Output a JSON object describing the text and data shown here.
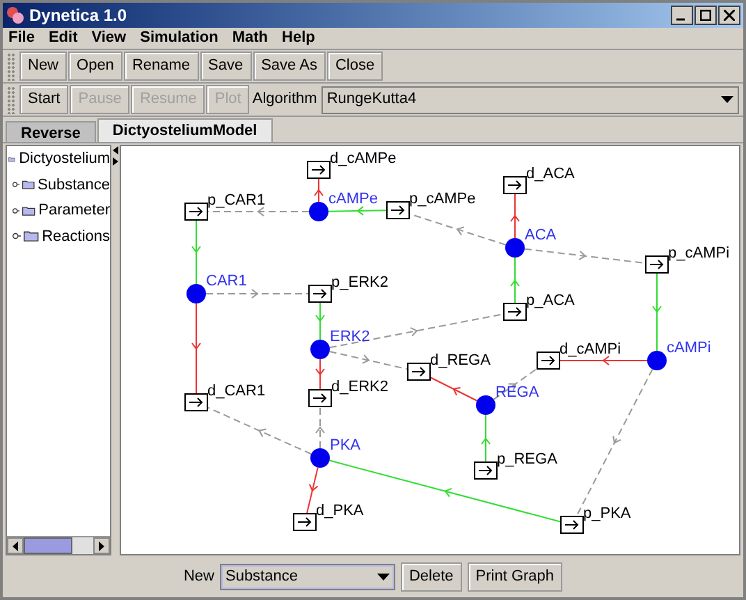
{
  "window": {
    "title": "Dynetica 1.0"
  },
  "menu": [
    "File",
    "Edit",
    "View",
    "Simulation",
    "Math",
    "Help"
  ],
  "toolbar": [
    {
      "label": "New",
      "disabled": false
    },
    {
      "label": "Open",
      "disabled": false
    },
    {
      "label": "Rename",
      "disabled": false
    },
    {
      "label": "Save",
      "disabled": false
    },
    {
      "label": "Save As",
      "disabled": false
    },
    {
      "label": "Close",
      "disabled": false
    }
  ],
  "sim_toolbar": {
    "buttons": [
      {
        "label": "Start",
        "disabled": false
      },
      {
        "label": "Pause",
        "disabled": true
      },
      {
        "label": "Resume",
        "disabled": true
      },
      {
        "label": "Plot",
        "disabled": true
      }
    ],
    "algorithm_label": "Algorithm",
    "algorithm": "RungeKutta4"
  },
  "tabs": [
    {
      "label": "Reverse",
      "selected": false
    },
    {
      "label": "DictyosteliumModel",
      "selected": true
    }
  ],
  "tree": {
    "label": "Dictyostelium",
    "children": [
      {
        "label": "Substance"
      },
      {
        "label": "Parameter"
      },
      {
        "label": "Reactions"
      }
    ]
  },
  "graph": {
    "nodes": [
      {
        "kind": "reaction",
        "label": "d_cAMPe"
      },
      {
        "kind": "reaction",
        "label": "d_ACA"
      },
      {
        "kind": "reaction",
        "label": "p_CAR1"
      },
      {
        "kind": "substance",
        "label": "cAMPe"
      },
      {
        "kind": "reaction",
        "label": "p_cAMPe"
      },
      {
        "kind": "substance",
        "label": "ACA"
      },
      {
        "kind": "reaction",
        "label": "p_cAMPi"
      },
      {
        "kind": "substance",
        "label": "CAR1"
      },
      {
        "kind": "reaction",
        "label": "p_ERK2"
      },
      {
        "kind": "reaction",
        "label": "p_ACA"
      },
      {
        "kind": "substance",
        "label": "ERK2"
      },
      {
        "kind": "reaction",
        "label": "d_cAMPi"
      },
      {
        "kind": "substance",
        "label": "cAMPi"
      },
      {
        "kind": "reaction",
        "label": "d_REGA"
      },
      {
        "kind": "reaction",
        "label": "d_CAR1"
      },
      {
        "kind": "reaction",
        "label": "d_ERK2"
      },
      {
        "kind": "substance",
        "label": "REGA"
      },
      {
        "kind": "substance",
        "label": "PKA"
      },
      {
        "kind": "reaction",
        "label": "p_REGA"
      },
      {
        "kind": "reaction",
        "label": "d_PKA"
      },
      {
        "kind": "reaction",
        "label": "p_PKA"
      }
    ]
  },
  "bottom": {
    "new_label": "New",
    "new_type": "Substance",
    "buttons": [
      "Delete",
      "Print Graph"
    ]
  }
}
